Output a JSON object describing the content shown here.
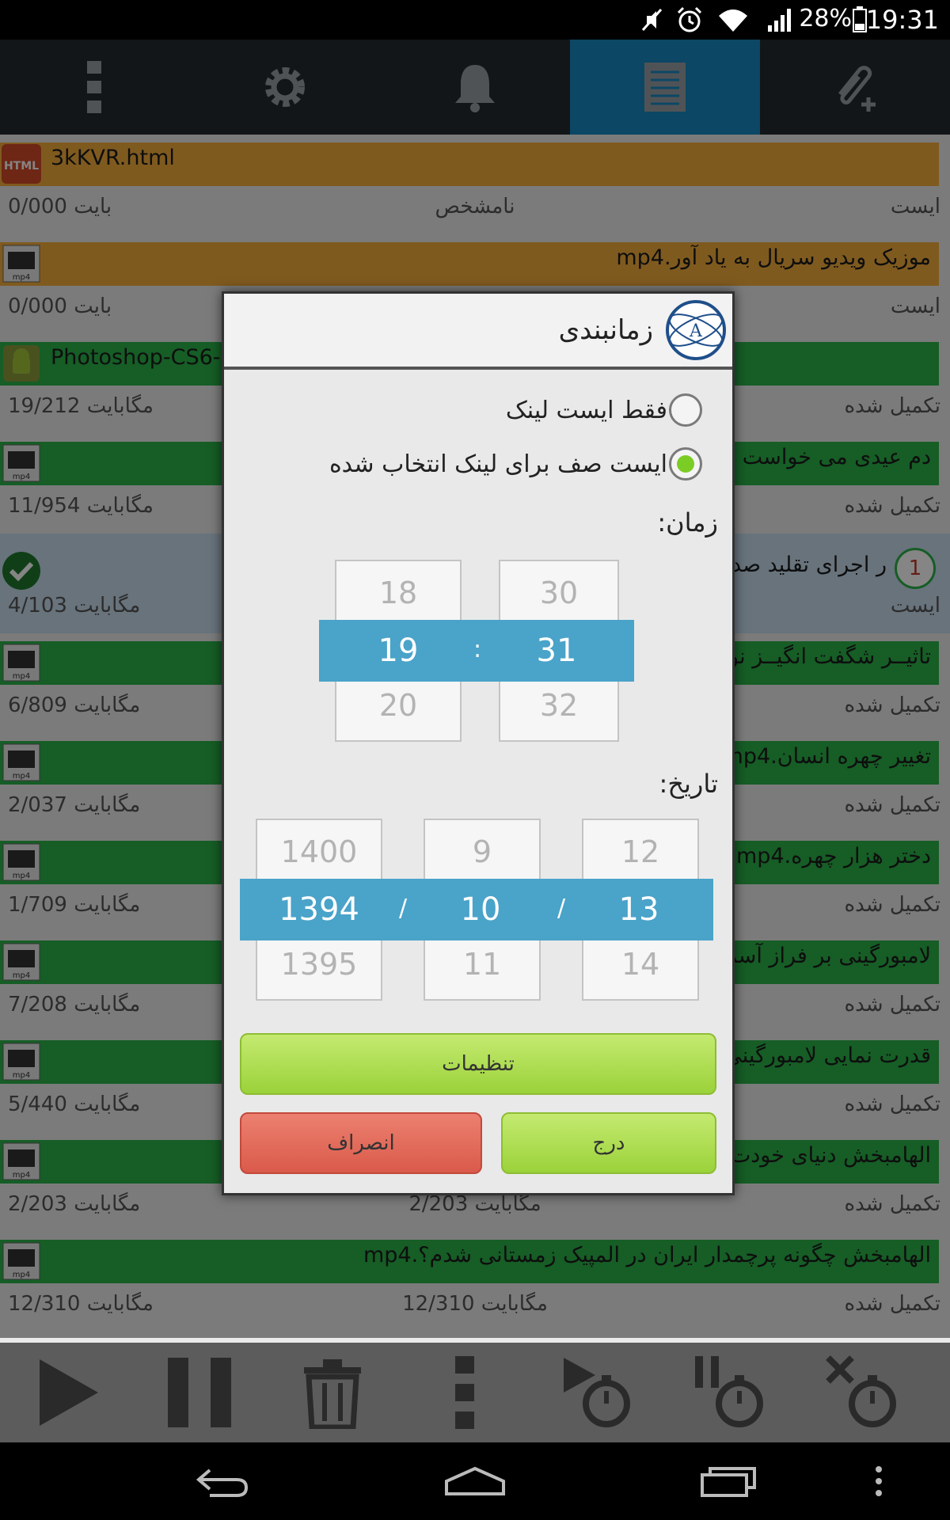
{
  "status_bar": {
    "battery_percent": "28%",
    "time": "19:31"
  },
  "toolbar": {
    "items": [
      "menu-more",
      "settings",
      "notifications",
      "download-list",
      "add-link"
    ],
    "active_index": 3
  },
  "downloads": [
    {
      "name": "3kKVR.html",
      "icon": "HTML",
      "color": "#f4ad3c",
      "size": "0/000 بایت",
      "middle": "نامشخص",
      "status": "ایست"
    },
    {
      "name": "موزیک ویدیو سریال به یاد آور.mp4",
      "icon": "mp4",
      "color": "#f4ad3c",
      "size": "0/000 بایت",
      "middle": "",
      "status": "ایست"
    },
    {
      "name": "Photoshop-CS6-",
      "icon": "android",
      "color": "#2bb24a",
      "size": "19/212 مگابایت",
      "middle": "",
      "status": "تکمیل شده"
    },
    {
      "name": "دم عیدی می خواست خو",
      "icon": "mp4",
      "color": "#2bb24a",
      "size": "11/954 مگابایت",
      "middle": "",
      "status": "تکمیل شده"
    },
    {
      "name": "ر اجرای تقلید صدای",
      "icon": "check",
      "color": "#c3dcec",
      "size": "4/103 مگابایت",
      "middle": "",
      "status": "ایست",
      "queue_number": "1"
    },
    {
      "name": "تاثیــر شگفت انگیــز نو",
      "icon": "mp4",
      "color": "#2bb24a",
      "size": "6/809 مگابایت",
      "middle": "",
      "status": "تکمیل شده"
    },
    {
      "name": "تغییر چهره انسان.mp4",
      "icon": "mp4",
      "color": "#2bb24a",
      "size": "2/037 مگابایت",
      "middle": "",
      "status": "تکمیل شده"
    },
    {
      "name": "دختر هزار چهره.mp4",
      "icon": "mp4",
      "color": "#2bb24a",
      "size": "1/709 مگابایت",
      "middle": "",
      "status": "تکمیل شده"
    },
    {
      "name": "لامبورگینی بر فراز آسما",
      "icon": "mp4",
      "color": "#2bb24a",
      "size": "7/208 مگابایت",
      "middle": "",
      "status": "تکمیل شده"
    },
    {
      "name": "قدرت نمایی لامبورگینی",
      "icon": "mp4",
      "color": "#2bb24a",
      "size": "5/440 مگابایت",
      "middle": "",
      "status": "تکمیل شده"
    },
    {
      "name": "الهامبخش دنیای خودت",
      "icon": "mp4",
      "color": "#2bb24a",
      "size": "2/203 مگابایت",
      "middle": "2/203 مگابایت",
      "status": "تکمیل شده"
    },
    {
      "name": "الهامبخش چگونه پرچمدار ایران در المپیک زمستانی شدم؟.mp4",
      "icon": "mp4",
      "color": "#2bb24a",
      "size": "12/310 مگابایت",
      "middle": "12/310 مگابایت",
      "status": "تکمیل شده"
    }
  ],
  "dialog": {
    "title": "زمانبندی",
    "option_stop_only": "فقط ایست لینک",
    "option_stop_queue": "ایست صف برای لینک انتخاب شده",
    "selected_option": "option_stop_queue",
    "time_label": "زمان:",
    "hour": {
      "prev": "18",
      "current": "19",
      "next": "20"
    },
    "minute": {
      "prev": "30",
      "current": "31",
      "next": "32"
    },
    "time_separator": ":",
    "date_label": "تاریخ:",
    "year": {
      "prev": "1400",
      "current": "1394",
      "next": "1395"
    },
    "month": {
      "prev": "9",
      "current": "10",
      "next": "11"
    },
    "day": {
      "prev": "12",
      "current": "13",
      "next": "14"
    },
    "date_separator": "/",
    "settings_button": "تنظیمات",
    "cancel_button": "انصراف",
    "insert_button": "درج"
  },
  "bottom_bar": {
    "items": [
      "play",
      "pause",
      "delete",
      "more",
      "schedule-start",
      "schedule-pause",
      "schedule-stop"
    ]
  },
  "colors": {
    "accent": "#1788c1",
    "picker_band": "#4aa3c9",
    "green_button": "#9bd23a",
    "red_button": "#da5a4a"
  }
}
